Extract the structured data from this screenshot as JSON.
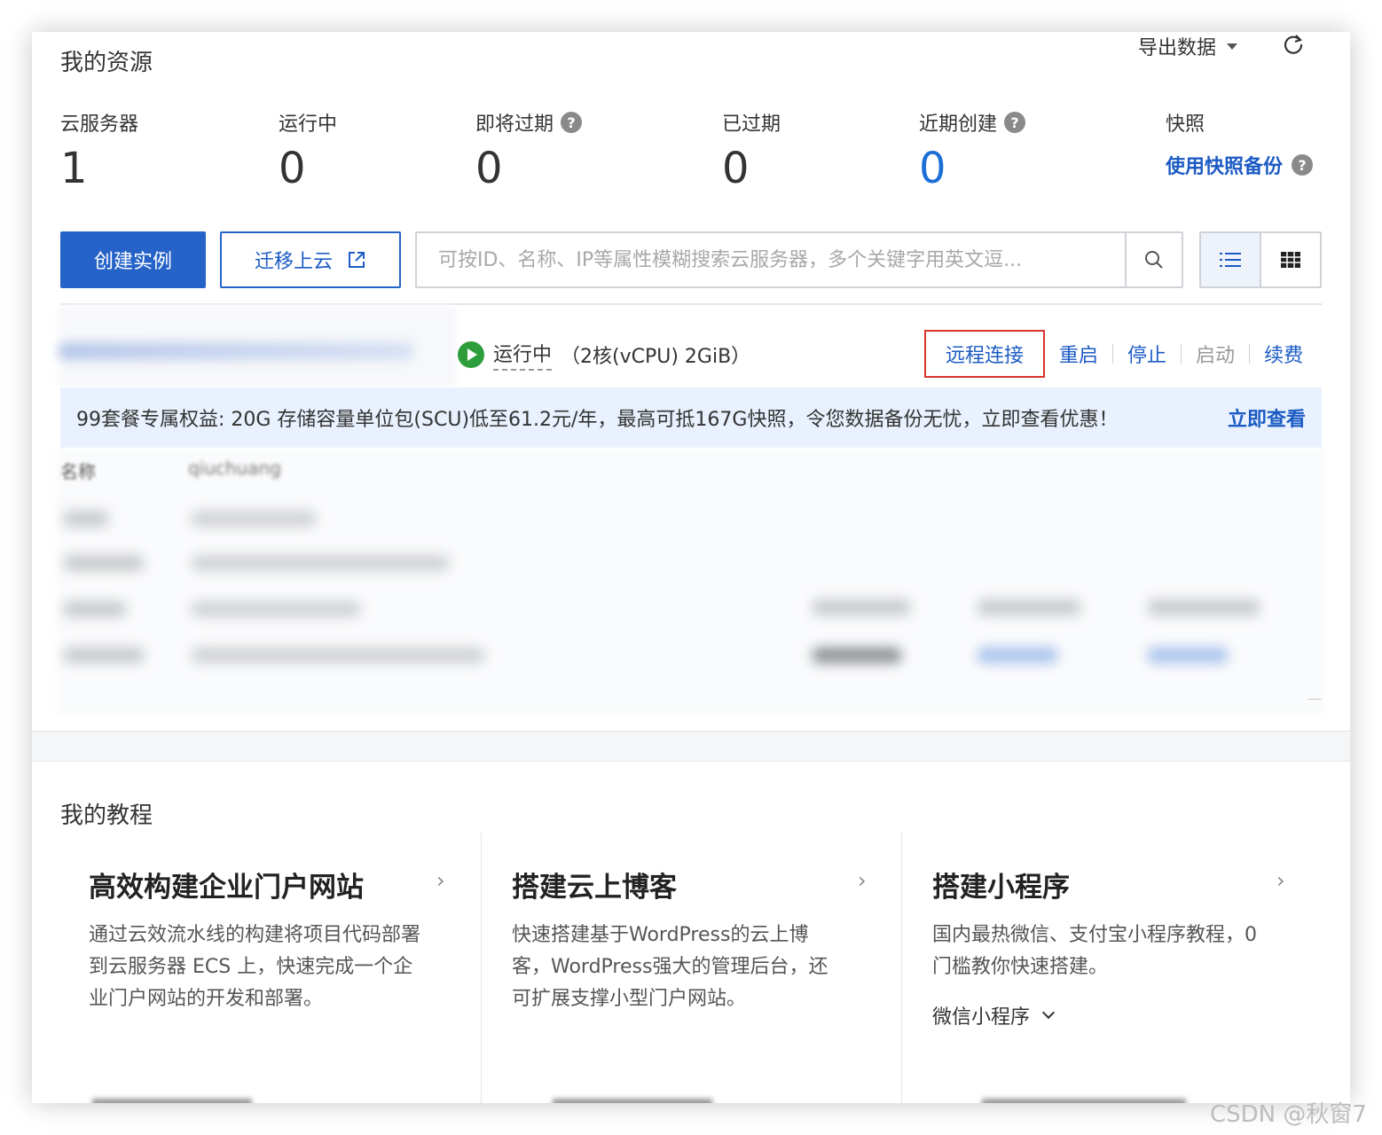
{
  "resources": {
    "title": "我的资源",
    "export_label": "导出数据",
    "stats": [
      {
        "label": "云服务器",
        "value": "1",
        "help": false
      },
      {
        "label": "运行中",
        "value": "0",
        "help": false
      },
      {
        "label": "即将过期",
        "value": "0",
        "help": true
      },
      {
        "label": "已过期",
        "value": "0",
        "help": false
      },
      {
        "label": "近期创建",
        "value": "0",
        "help": true
      }
    ],
    "snapshot": {
      "label": "快照",
      "link": "使用快照备份"
    }
  },
  "toolbar": {
    "create_label": "创建实例",
    "migrate_label": "迁移上云",
    "search_placeholder": "可按ID、名称、IP等属性模糊搜索云服务器，多个关键字用英文逗..."
  },
  "instance": {
    "status": "运行中",
    "spec": "（2核(vCPU) 2GiB）",
    "actions": {
      "remote": "远程连接",
      "restart": "重启",
      "stop": "停止",
      "start": "启动",
      "renew": "续费"
    },
    "detail_name_key": "名称",
    "detail_name_value": "qiuchuang"
  },
  "banner": {
    "text": "99套餐专属权益: 20G 存储容量单位包(SCU)低至61.2元/年，最高可抵167G快照，令您数据备份无忧，立即查看优惠！",
    "link": "立即查看"
  },
  "tutorials": {
    "title": "我的教程",
    "items": [
      {
        "title": "高效构建企业门户网站",
        "desc1": "通过云效流水线的构建将项目代码部署",
        "desc2": "到云服务器 ECS 上，快速完成一个企",
        "desc3": "业门户网站的开发和部署。"
      },
      {
        "title": "搭建云上博客",
        "desc1": "快速搭建基于WordPress的云上博",
        "desc2": "客，WordPress强大的管理后台，还",
        "desc3": "可扩展支撑小型门户网站。"
      },
      {
        "title": "搭建小程序",
        "desc1": "国内最热微信、支付宝小程序教程，0",
        "desc2": "门槛教你快速搭建。",
        "desc3": "",
        "select": "微信小程序"
      }
    ]
  },
  "watermark": "CSDN @秋窗7",
  "colors": {
    "accent": "#2563c9",
    "link": "#1c5bc4",
    "running": "#2e9e3c",
    "highlight": "#d7342c",
    "banner_bg": "#e8f1fd"
  }
}
